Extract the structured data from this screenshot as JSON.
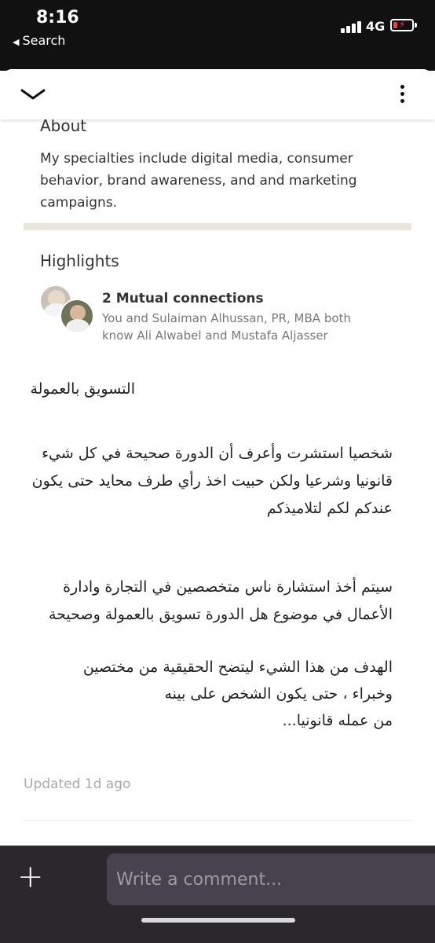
{
  "status_bar": {
    "time": "8:16",
    "back_label": "Search",
    "network": "4G"
  },
  "about": {
    "title": "About",
    "text": "My specialties include digital media, consumer behavior, brand awareness, and and marketing campaigns."
  },
  "highlights": {
    "title": "Highlights",
    "mutual_title": "2 Mutual connections",
    "mutual_sub": "You and Sulaiman Alhussan, PR, MBA both know Ali Alwabel and Mustafa Aljasser"
  },
  "post": {
    "heading": "التسويق بالعمولة",
    "para1": "شخصيا استشرت وأعرف أن الدورة صحيحة في كل شيء قانونيا وشرعيا ولكن حبيت اخذ رأي طرف محايد حتى يكون عندكم لكم لتلاميذكم",
    "para2": "سيتم أخذ استشارة ناس متخصصين في التجارة وادارة الأعمال في موضوع هل الدورة تسويق بالعمولة وصحيحة",
    "para3_line1": "الهدف من هذا الشيء ليتضح الحقيقية من مختصين",
    "para3_line2": "وخبراء ، حتى يكون الشخص على بينه",
    "para3_line3": "من عمله قانونيا..."
  },
  "updated": "Updated 1d ago",
  "comment": {
    "placeholder": "Write a comment..."
  }
}
